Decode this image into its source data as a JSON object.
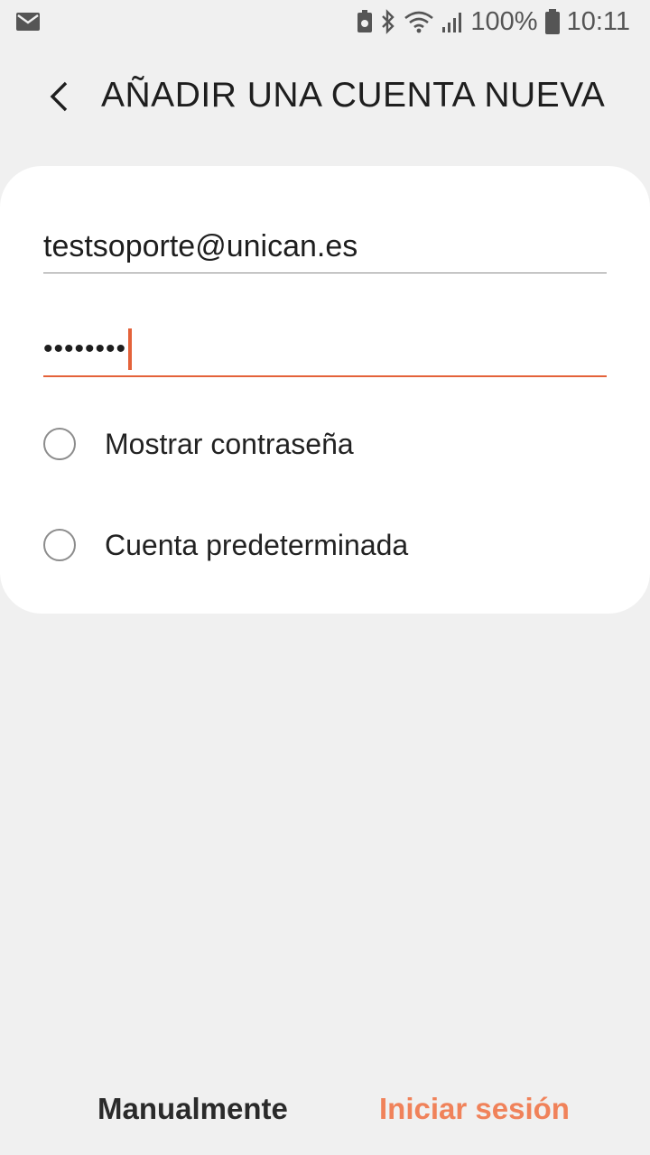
{
  "status_bar": {
    "battery": "100%",
    "time": "10:11",
    "icons": [
      "mail-icon",
      "battery-saver-icon",
      "bluetooth-icon",
      "wifi-icon",
      "signal-icon",
      "battery-icon"
    ]
  },
  "header": {
    "back_icon": "chevron-left-icon",
    "title": "AÑADIR UNA CUENTA NUEVA"
  },
  "form": {
    "email_value": "testsoporte@unican.es",
    "password_value": "••••••••",
    "show_password_label": "Mostrar contraseña",
    "default_account_label": "Cuenta predeterminada"
  },
  "actions": {
    "manual_label": "Manualmente",
    "login_label": "Iniciar sesión"
  },
  "colors": {
    "accent": "#e4623a",
    "login_button": "#f0825a",
    "background": "#f0f0f0"
  }
}
